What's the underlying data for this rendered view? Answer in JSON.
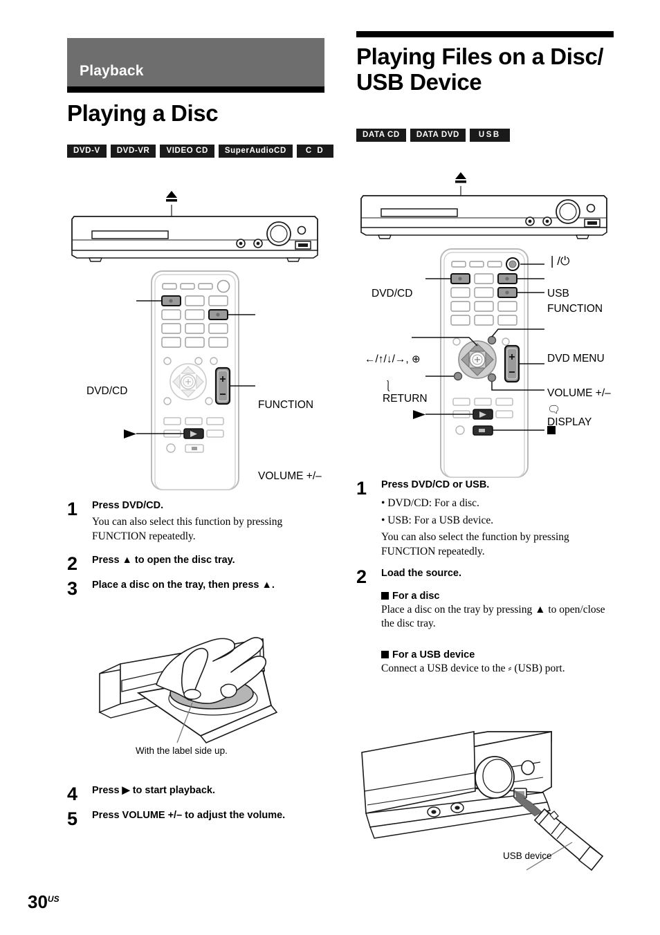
{
  "page": {
    "number": "30",
    "region": "US"
  },
  "left": {
    "section_band": "Playback",
    "title": "Playing a Disc",
    "badges": [
      {
        "label": "DVD-V"
      },
      {
        "label": "DVD-VR"
      },
      {
        "label": "VIDEO CD"
      },
      {
        "label": "SuperAudioCD"
      },
      {
        "label": "C D"
      }
    ],
    "diagram_labels": {
      "dvd_cd": "DVD/CD",
      "function": "FUNCTION",
      "volume": "VOLUME +/–"
    },
    "steps": [
      {
        "num": "1",
        "title": "Press DVD/CD.",
        "note": "You can also select this function by pressing FUNCTION repeatedly."
      },
      {
        "num": "2",
        "title": "Press ▲ to open the disc tray."
      },
      {
        "num": "3",
        "title": "Place a disc on the tray, then press ▲."
      },
      {
        "num": "4",
        "title": "Press ▶ to start playback."
      },
      {
        "num": "5",
        "title": "Press VOLUME +/– to adjust the volume."
      }
    ],
    "disc_caption": "With the label side up."
  },
  "right": {
    "title": "Playing Files on a Disc/\nUSB Device",
    "badges": [
      {
        "label": "DATA CD"
      },
      {
        "label": "DATA DVD"
      },
      {
        "label": "USB"
      }
    ],
    "diagram_labels": {
      "dvd_cd": "DVD/CD",
      "power": "❘/⏻",
      "usb": "USB",
      "function": "FUNCTION",
      "cursor": "←/↑/↓/→,",
      "dvd_menu": "DVD MENU",
      "return": "RETURN",
      "volume": "VOLUME +/–",
      "display": "DISPLAY"
    },
    "steps": [
      {
        "num": "1",
        "title": "Press DVD/CD or USB.",
        "bullets": [
          "• DVD/CD: For a disc.",
          "• USB: For a USB device."
        ],
        "note": "You can also select the function by pressing FUNCTION repeatedly."
      },
      {
        "num": "2",
        "title": "Load the source.",
        "sub": [
          {
            "head": "For a disc",
            "body": "Place a disc on the tray by pressing ▲ to open/close the disc tray."
          },
          {
            "head": "For a USB device",
            "body": "Connect a USB device to the ⸗ (USB) port."
          }
        ]
      }
    ],
    "usb_caption": "USB device"
  },
  "colors": {
    "band_gray": "#6e6e6e",
    "rule_black": "#000000",
    "badge_bg": "#1a1a1a",
    "line_gray": "#808080",
    "button_fill": "#9a9a9a"
  }
}
